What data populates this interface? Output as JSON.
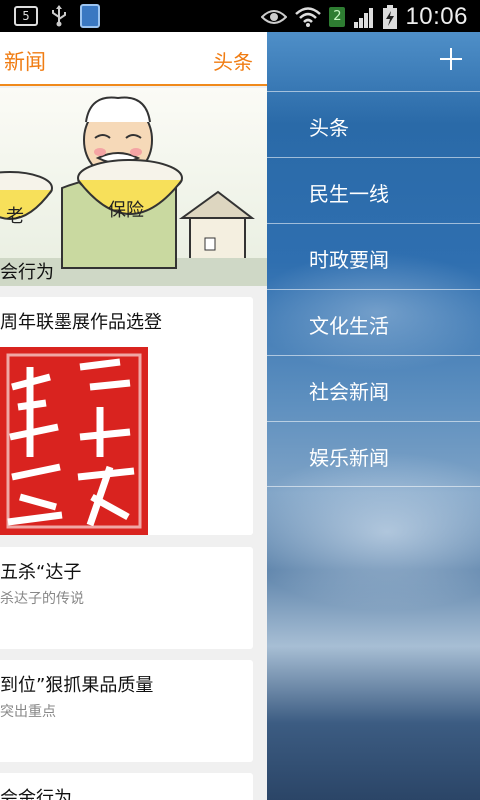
{
  "status_bar": {
    "notification_count": "5",
    "sim_badge": "2",
    "time": "10:06"
  },
  "header": {
    "title": "新闻",
    "current_category": "头条"
  },
  "feed": {
    "hero_caption": "会行为",
    "items": [
      {
        "title": "周年联墨展作品选登",
        "subtitle": ""
      },
      {
        "title": "五杀“达子",
        "subtitle": "杀达子的传说"
      },
      {
        "title": "到位”狠抓果品质量",
        "subtitle": "突出重点"
      },
      {
        "title": "会金行为",
        "subtitle": ""
      }
    ]
  },
  "drawer": {
    "categories": [
      "头条",
      "民生一线",
      "时政要闻",
      "文化生活",
      "社会新闻",
      "娱乐新闻"
    ]
  },
  "colors": {
    "accent": "#f07c12",
    "drawer_bg": "#2f6fb0"
  }
}
